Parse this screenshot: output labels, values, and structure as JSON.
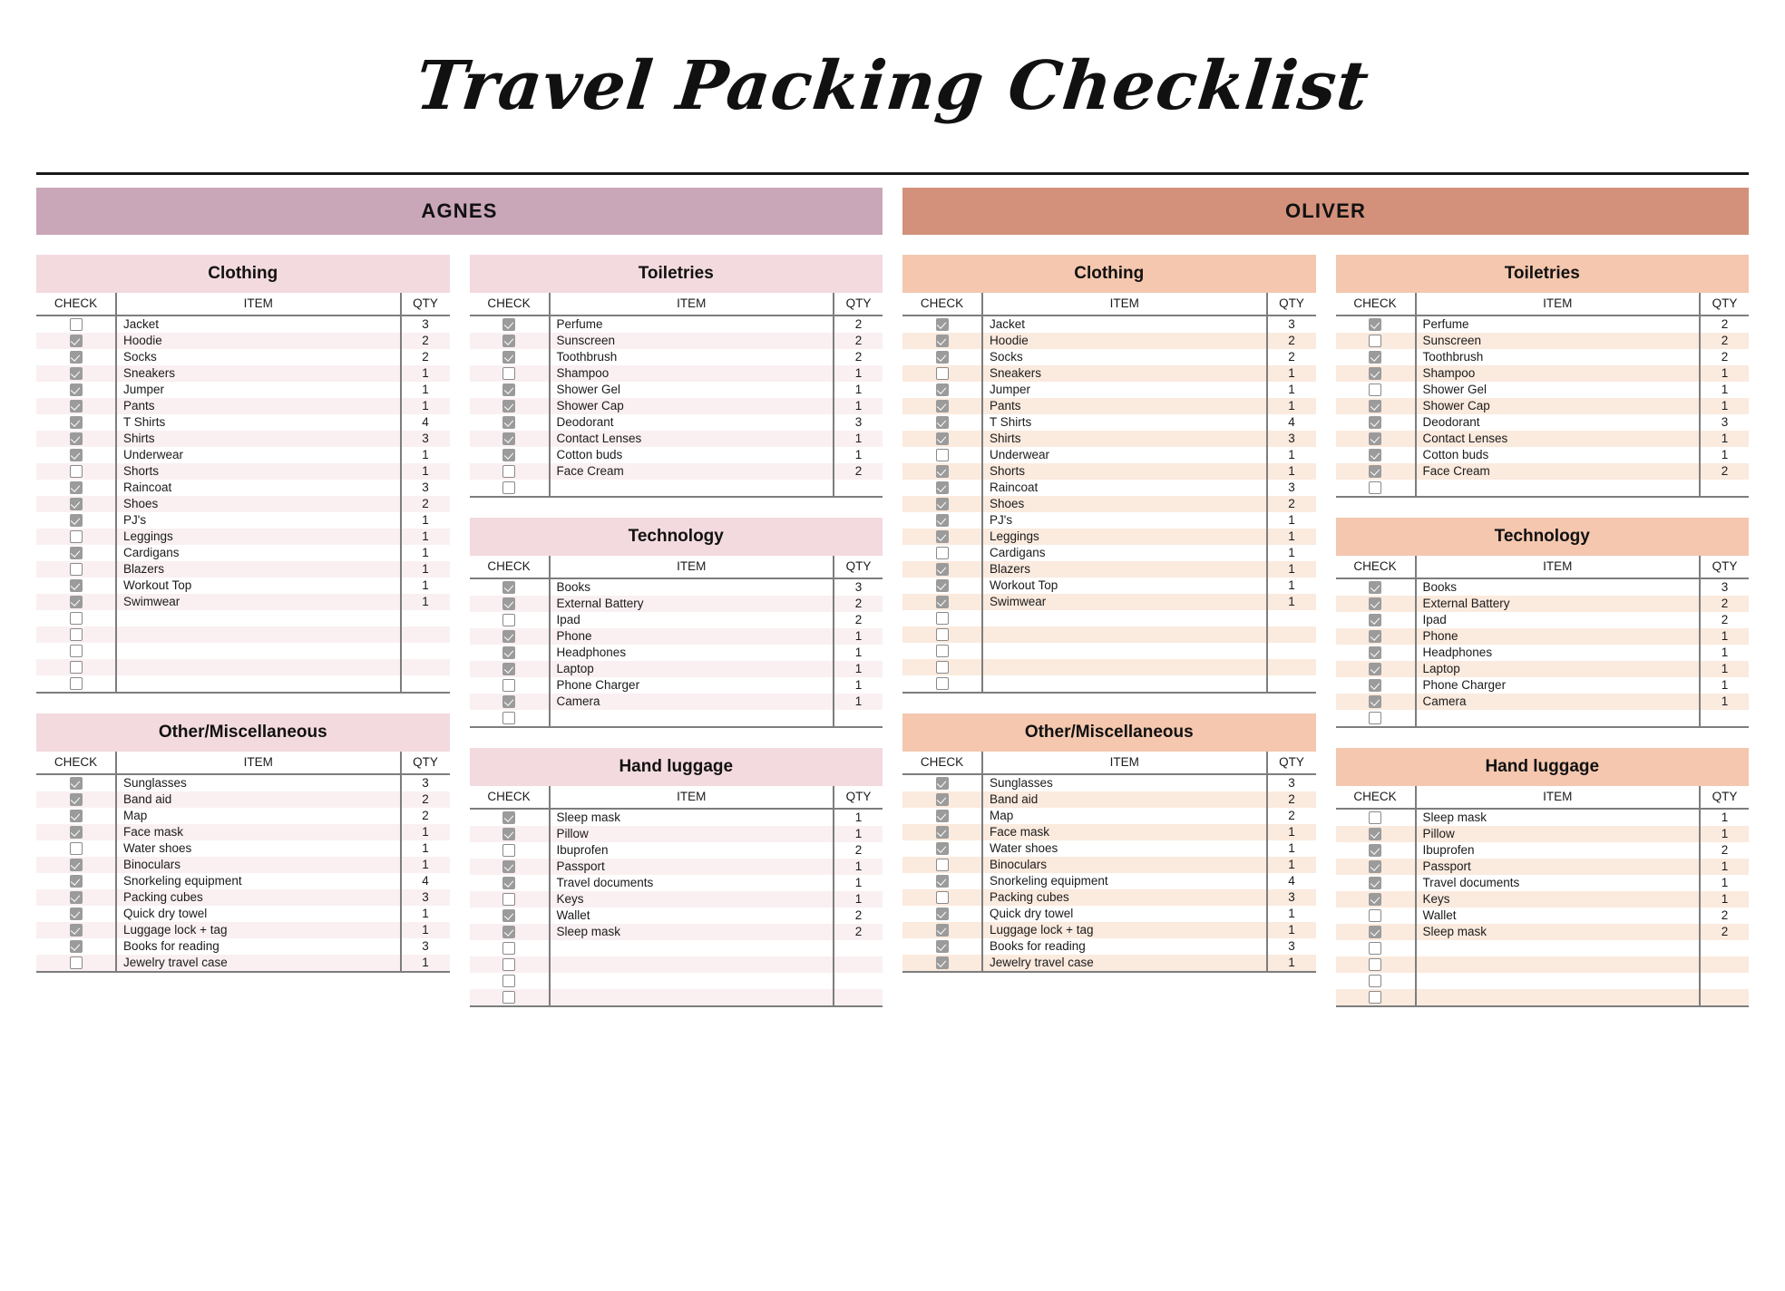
{
  "document": {
    "title": "Travel Packing Checklist"
  },
  "colors": {
    "agnes_banner": "#c9a6b8",
    "oliver_banner": "#d3917c",
    "agnes_category": "#f3dade",
    "oliver_category": "#f4c7ae",
    "agnes_stripe": "#faf0f1",
    "oliver_stripe": "#fbeade",
    "checkbox_checked": "#9b9b9b",
    "checkbox_border": "#8a8a8a"
  },
  "columns": {
    "check": "CHECK",
    "item": "ITEM",
    "qty": "QTY"
  },
  "persons": [
    {
      "name": "AGNES",
      "left_categories": [
        {
          "title": "Clothing",
          "rows": [
            {
              "checked": false,
              "item": "Jacket",
              "qty": "3"
            },
            {
              "checked": true,
              "item": "Hoodie",
              "qty": "2"
            },
            {
              "checked": true,
              "item": "Socks",
              "qty": "2"
            },
            {
              "checked": true,
              "item": "Sneakers",
              "qty": "1"
            },
            {
              "checked": true,
              "item": "Jumper",
              "qty": "1"
            },
            {
              "checked": true,
              "item": "Pants",
              "qty": "1"
            },
            {
              "checked": true,
              "item": "T Shirts",
              "qty": "4"
            },
            {
              "checked": true,
              "item": "Shirts",
              "qty": "3"
            },
            {
              "checked": true,
              "item": "Underwear",
              "qty": "1"
            },
            {
              "checked": false,
              "item": "Shorts",
              "qty": "1"
            },
            {
              "checked": true,
              "item": "Raincoat",
              "qty": "3"
            },
            {
              "checked": true,
              "item": "Shoes",
              "qty": "2"
            },
            {
              "checked": true,
              "item": "PJ's",
              "qty": "1"
            },
            {
              "checked": false,
              "item": "Leggings",
              "qty": "1"
            },
            {
              "checked": true,
              "item": "Cardigans",
              "qty": "1"
            },
            {
              "checked": false,
              "item": "Blazers",
              "qty": "1"
            },
            {
              "checked": true,
              "item": "Workout Top",
              "qty": "1"
            },
            {
              "checked": true,
              "item": "Swimwear",
              "qty": "1"
            },
            {
              "checked": false,
              "item": "",
              "qty": ""
            },
            {
              "checked": false,
              "item": "",
              "qty": ""
            },
            {
              "checked": false,
              "item": "",
              "qty": ""
            },
            {
              "checked": false,
              "item": "",
              "qty": ""
            },
            {
              "checked": false,
              "item": "",
              "qty": ""
            }
          ]
        },
        {
          "title": "Other/Miscellaneous",
          "rows": [
            {
              "checked": true,
              "item": "Sunglasses",
              "qty": "3"
            },
            {
              "checked": true,
              "item": "Band aid",
              "qty": "2"
            },
            {
              "checked": true,
              "item": "Map",
              "qty": "2"
            },
            {
              "checked": true,
              "item": "Face mask",
              "qty": "1"
            },
            {
              "checked": false,
              "item": "Water shoes",
              "qty": "1"
            },
            {
              "checked": true,
              "item": "Binoculars",
              "qty": "1"
            },
            {
              "checked": true,
              "item": "Snorkeling equipment",
              "qty": "4"
            },
            {
              "checked": true,
              "item": "Packing cubes",
              "qty": "3"
            },
            {
              "checked": true,
              "item": "Quick dry towel",
              "qty": "1"
            },
            {
              "checked": true,
              "item": "Luggage lock + tag",
              "qty": "1"
            },
            {
              "checked": true,
              "item": "Books for reading",
              "qty": "3"
            },
            {
              "checked": false,
              "item": "Jewelry travel case",
              "qty": "1"
            }
          ]
        }
      ],
      "right_categories": [
        {
          "title": "Toiletries",
          "rows": [
            {
              "checked": true,
              "item": "Perfume",
              "qty": "2"
            },
            {
              "checked": true,
              "item": "Sunscreen",
              "qty": "2"
            },
            {
              "checked": true,
              "item": "Toothbrush",
              "qty": "2"
            },
            {
              "checked": false,
              "item": "Shampoo",
              "qty": "1"
            },
            {
              "checked": true,
              "item": "Shower Gel",
              "qty": "1"
            },
            {
              "checked": true,
              "item": "Shower Cap",
              "qty": "1"
            },
            {
              "checked": true,
              "item": "Deodorant",
              "qty": "3"
            },
            {
              "checked": true,
              "item": "Contact Lenses",
              "qty": "1"
            },
            {
              "checked": true,
              "item": "Cotton buds",
              "qty": "1"
            },
            {
              "checked": false,
              "item": "Face Cream",
              "qty": "2"
            },
            {
              "checked": false,
              "item": "",
              "qty": ""
            }
          ]
        },
        {
          "title": "Technology",
          "rows": [
            {
              "checked": true,
              "item": "Books",
              "qty": "3"
            },
            {
              "checked": true,
              "item": "External Battery",
              "qty": "2"
            },
            {
              "checked": false,
              "item": "Ipad",
              "qty": "2"
            },
            {
              "checked": true,
              "item": "Phone",
              "qty": "1"
            },
            {
              "checked": true,
              "item": "Headphones",
              "qty": "1"
            },
            {
              "checked": true,
              "item": "Laptop",
              "qty": "1"
            },
            {
              "checked": false,
              "item": "Phone Charger",
              "qty": "1"
            },
            {
              "checked": true,
              "item": "Camera",
              "qty": "1"
            },
            {
              "checked": false,
              "item": "",
              "qty": ""
            }
          ]
        },
        {
          "title": "Hand luggage",
          "rows": [
            {
              "checked": true,
              "item": "Sleep mask",
              "qty": "1"
            },
            {
              "checked": true,
              "item": "Pillow",
              "qty": "1"
            },
            {
              "checked": false,
              "item": "Ibuprofen",
              "qty": "2"
            },
            {
              "checked": true,
              "item": "Passport",
              "qty": "1"
            },
            {
              "checked": true,
              "item": "Travel documents",
              "qty": "1"
            },
            {
              "checked": false,
              "item": "Keys",
              "qty": "1"
            },
            {
              "checked": true,
              "item": "Wallet",
              "qty": "2"
            },
            {
              "checked": true,
              "item": "Sleep mask",
              "qty": "2"
            },
            {
              "checked": false,
              "item": "",
              "qty": ""
            },
            {
              "checked": false,
              "item": "",
              "qty": ""
            },
            {
              "checked": false,
              "item": "",
              "qty": ""
            },
            {
              "checked": false,
              "item": "",
              "qty": ""
            }
          ]
        }
      ]
    },
    {
      "name": "OLIVER",
      "left_categories": [
        {
          "title": "Clothing",
          "rows": [
            {
              "checked": true,
              "item": "Jacket",
              "qty": "3"
            },
            {
              "checked": true,
              "item": "Hoodie",
              "qty": "2"
            },
            {
              "checked": true,
              "item": "Socks",
              "qty": "2"
            },
            {
              "checked": false,
              "item": "Sneakers",
              "qty": "1"
            },
            {
              "checked": true,
              "item": "Jumper",
              "qty": "1"
            },
            {
              "checked": true,
              "item": "Pants",
              "qty": "1"
            },
            {
              "checked": true,
              "item": "T Shirts",
              "qty": "4"
            },
            {
              "checked": true,
              "item": "Shirts",
              "qty": "3"
            },
            {
              "checked": false,
              "item": "Underwear",
              "qty": "1"
            },
            {
              "checked": true,
              "item": "Shorts",
              "qty": "1"
            },
            {
              "checked": true,
              "item": "Raincoat",
              "qty": "3"
            },
            {
              "checked": true,
              "item": "Shoes",
              "qty": "2"
            },
            {
              "checked": true,
              "item": "PJ's",
              "qty": "1"
            },
            {
              "checked": true,
              "item": "Leggings",
              "qty": "1"
            },
            {
              "checked": false,
              "item": "Cardigans",
              "qty": "1"
            },
            {
              "checked": true,
              "item": "Blazers",
              "qty": "1"
            },
            {
              "checked": true,
              "item": "Workout Top",
              "qty": "1"
            },
            {
              "checked": true,
              "item": "Swimwear",
              "qty": "1"
            },
            {
              "checked": false,
              "item": "",
              "qty": ""
            },
            {
              "checked": false,
              "item": "",
              "qty": ""
            },
            {
              "checked": false,
              "item": "",
              "qty": ""
            },
            {
              "checked": false,
              "item": "",
              "qty": ""
            },
            {
              "checked": false,
              "item": "",
              "qty": ""
            }
          ]
        },
        {
          "title": "Other/Miscellaneous",
          "rows": [
            {
              "checked": true,
              "item": "Sunglasses",
              "qty": "3"
            },
            {
              "checked": true,
              "item": "Band aid",
              "qty": "2"
            },
            {
              "checked": true,
              "item": "Map",
              "qty": "2"
            },
            {
              "checked": true,
              "item": "Face mask",
              "qty": "1"
            },
            {
              "checked": true,
              "item": "Water shoes",
              "qty": "1"
            },
            {
              "checked": false,
              "item": "Binoculars",
              "qty": "1"
            },
            {
              "checked": true,
              "item": "Snorkeling equipment",
              "qty": "4"
            },
            {
              "checked": false,
              "item": "Packing cubes",
              "qty": "3"
            },
            {
              "checked": true,
              "item": "Quick dry towel",
              "qty": "1"
            },
            {
              "checked": true,
              "item": "Luggage lock + tag",
              "qty": "1"
            },
            {
              "checked": true,
              "item": "Books for reading",
              "qty": "3"
            },
            {
              "checked": true,
              "item": "Jewelry travel case",
              "qty": "1"
            }
          ]
        }
      ],
      "right_categories": [
        {
          "title": "Toiletries",
          "rows": [
            {
              "checked": true,
              "item": "Perfume",
              "qty": "2"
            },
            {
              "checked": false,
              "item": "Sunscreen",
              "qty": "2"
            },
            {
              "checked": true,
              "item": "Toothbrush",
              "qty": "2"
            },
            {
              "checked": true,
              "item": "Shampoo",
              "qty": "1"
            },
            {
              "checked": false,
              "item": "Shower Gel",
              "qty": "1"
            },
            {
              "checked": true,
              "item": "Shower Cap",
              "qty": "1"
            },
            {
              "checked": true,
              "item": "Deodorant",
              "qty": "3"
            },
            {
              "checked": true,
              "item": "Contact Lenses",
              "qty": "1"
            },
            {
              "checked": true,
              "item": "Cotton buds",
              "qty": "1"
            },
            {
              "checked": true,
              "item": "Face Cream",
              "qty": "2"
            },
            {
              "checked": false,
              "item": "",
              "qty": ""
            }
          ]
        },
        {
          "title": "Technology",
          "rows": [
            {
              "checked": true,
              "item": "Books",
              "qty": "3"
            },
            {
              "checked": true,
              "item": "External Battery",
              "qty": "2"
            },
            {
              "checked": true,
              "item": "Ipad",
              "qty": "2"
            },
            {
              "checked": true,
              "item": "Phone",
              "qty": "1"
            },
            {
              "checked": true,
              "item": "Headphones",
              "qty": "1"
            },
            {
              "checked": true,
              "item": "Laptop",
              "qty": "1"
            },
            {
              "checked": true,
              "item": "Phone Charger",
              "qty": "1"
            },
            {
              "checked": true,
              "item": "Camera",
              "qty": "1"
            },
            {
              "checked": false,
              "item": "",
              "qty": ""
            }
          ]
        },
        {
          "title": "Hand luggage",
          "rows": [
            {
              "checked": false,
              "item": "Sleep mask",
              "qty": "1"
            },
            {
              "checked": true,
              "item": "Pillow",
              "qty": "1"
            },
            {
              "checked": true,
              "item": "Ibuprofen",
              "qty": "2"
            },
            {
              "checked": true,
              "item": "Passport",
              "qty": "1"
            },
            {
              "checked": true,
              "item": "Travel documents",
              "qty": "1"
            },
            {
              "checked": true,
              "item": "Keys",
              "qty": "1"
            },
            {
              "checked": false,
              "item": "Wallet",
              "qty": "2"
            },
            {
              "checked": true,
              "item": "Sleep mask",
              "qty": "2"
            },
            {
              "checked": false,
              "item": "",
              "qty": ""
            },
            {
              "checked": false,
              "item": "",
              "qty": ""
            },
            {
              "checked": false,
              "item": "",
              "qty": ""
            },
            {
              "checked": false,
              "item": "",
              "qty": ""
            }
          ]
        }
      ]
    }
  ]
}
